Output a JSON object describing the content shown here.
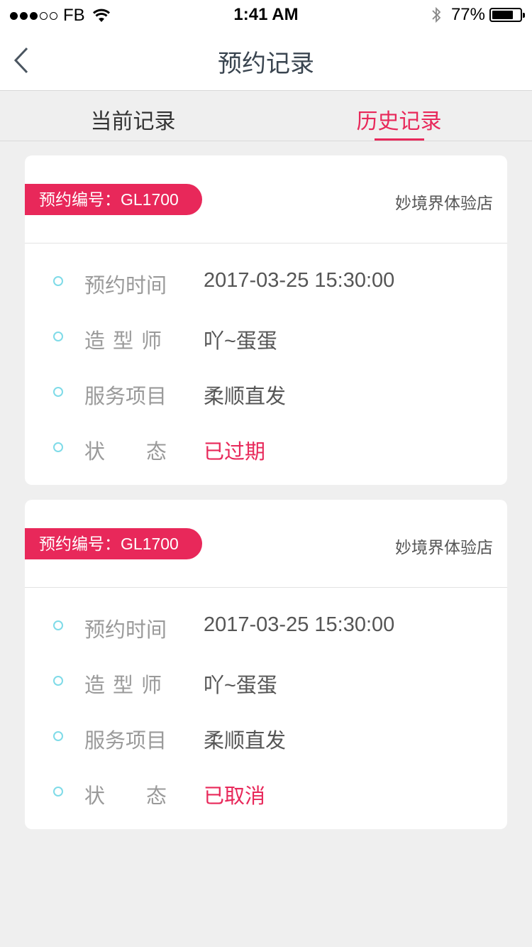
{
  "status_bar": {
    "carrier": "FB",
    "time": "1:41 AM",
    "battery": "77%",
    "battery_level": 0.77
  },
  "nav": {
    "title": "预约记录",
    "back_icon": "chevron-left-icon"
  },
  "tabs": [
    {
      "label": "当前记录",
      "active": false
    },
    {
      "label": "历史记录",
      "active": true
    }
  ],
  "colors": {
    "accent": "#e8285a",
    "dot": "#7fdbe8",
    "background": "#efefef"
  },
  "records": [
    {
      "order_no": "预约编号：GL1700",
      "store": "妙境界体验店",
      "labels": {
        "time": "预约时间",
        "stylist": "造型师",
        "service": "服务项目",
        "status_a": "状",
        "status_b": "态"
      },
      "values": {
        "time": "2017-03-25 15:30:00",
        "stylist": "吖~蛋蛋",
        "service": "柔顺直发",
        "status": "已过期"
      }
    },
    {
      "order_no": "预约编号：GL1700",
      "store": "妙境界体验店",
      "labels": {
        "time": "预约时间",
        "stylist": "造型师",
        "service": "服务项目",
        "status_a": "状",
        "status_b": "态"
      },
      "values": {
        "time": "2017-03-25 15:30:00",
        "stylist": "吖~蛋蛋",
        "service": "柔顺直发",
        "status": "已取消"
      }
    }
  ]
}
